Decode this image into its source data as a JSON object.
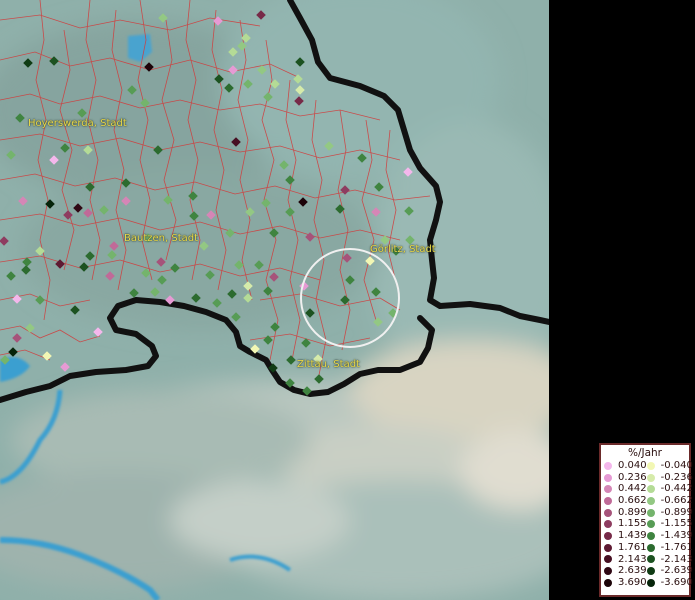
{
  "map": {
    "places": [
      {
        "id": "hoyerswerda",
        "name": "Hoyerswerda, Stadt"
      },
      {
        "id": "bautzen",
        "name": "Bautzen, Stadt"
      },
      {
        "id": "goerlitz",
        "name": "Görlitz, Stadt"
      },
      {
        "id": "zittau",
        "name": "Zittau, Stadt"
      }
    ],
    "colors": {
      "background": "#8fb0aa",
      "district_border": "#d23a3a",
      "national_border": "#111111",
      "water": "#3a9fd0",
      "selection_circle": "#f0f0f0"
    }
  },
  "legend": {
    "title": "%/Jahr",
    "positive": [
      {
        "label": "0.040",
        "color": "#f4b7ec"
      },
      {
        "label": "0.236",
        "color": "#e69ad4"
      },
      {
        "label": "0.442",
        "color": "#d586b6"
      },
      {
        "label": "0.662",
        "color": "#c06a98"
      },
      {
        "label": "0.899",
        "color": "#a6537a"
      },
      {
        "label": "1.155",
        "color": "#8e3c60"
      },
      {
        "label": "1.439",
        "color": "#772a48"
      },
      {
        "label": "1.761",
        "color": "#5e1a32"
      },
      {
        "label": "2.143",
        "color": "#470f22"
      },
      {
        "label": "2.639",
        "color": "#300814"
      },
      {
        "label": "3.690",
        "color": "#1c0308"
      }
    ],
    "negative": [
      {
        "label": "-0.040",
        "color": "#f2f7b4"
      },
      {
        "label": "-0.236",
        "color": "#d6ebaa"
      },
      {
        "label": "-0.442",
        "color": "#b4db96"
      },
      {
        "label": "-0.662",
        "color": "#93c883"
      },
      {
        "label": "-0.899",
        "color": "#74b46c"
      },
      {
        "label": "-1.155",
        "color": "#579c55"
      },
      {
        "label": "-1.439",
        "color": "#3f8440"
      },
      {
        "label": "-1.761",
        "color": "#2c6b2f"
      },
      {
        "label": "-2.143",
        "color": "#1c5220"
      },
      {
        "label": "-2.639",
        "color": "#103c14"
      },
      {
        "label": "-3.690",
        "color": "#06240a"
      }
    ]
  }
}
